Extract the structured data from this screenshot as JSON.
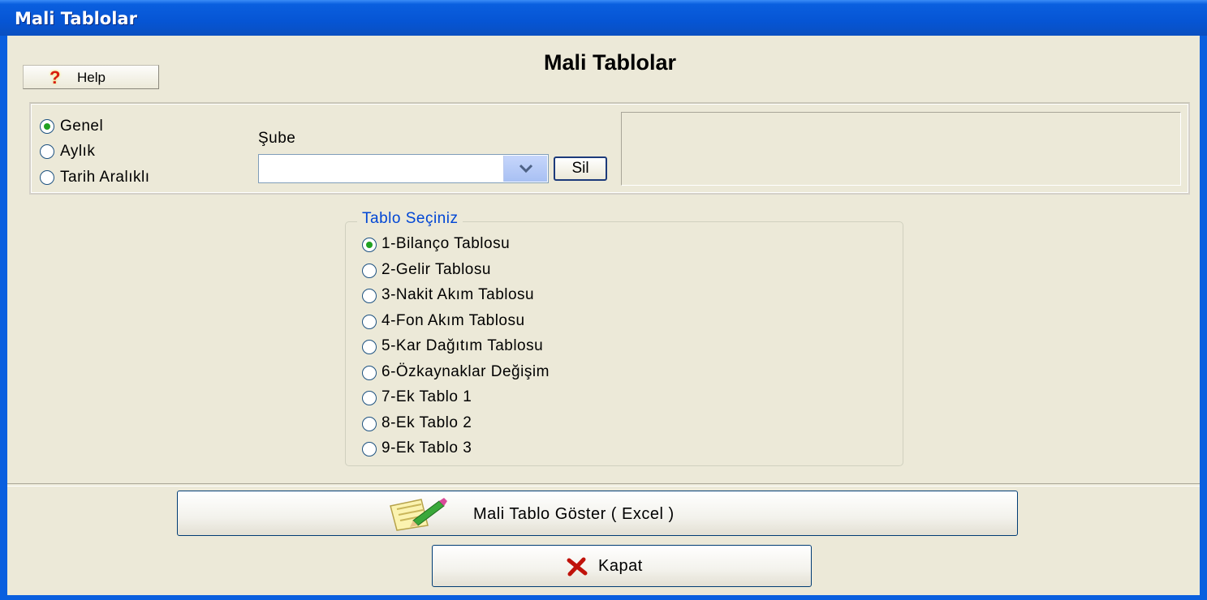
{
  "window": {
    "title": "Mali Tablolar"
  },
  "header": {
    "title": "Mali Tablolar",
    "help_label": "Help"
  },
  "period": {
    "options": [
      {
        "label": "Genel",
        "checked": true
      },
      {
        "label": "Aylık",
        "checked": false
      },
      {
        "label": "Tarih Aralıklı",
        "checked": false
      }
    ]
  },
  "branch": {
    "label": "Şube",
    "value": "",
    "clear_label": "Sil"
  },
  "table_group": {
    "legend": "Tablo Seçiniz",
    "options": [
      {
        "label": "1-Bilanço Tablosu",
        "checked": true
      },
      {
        "label": "2-Gelir Tablosu",
        "checked": false
      },
      {
        "label": "3-Nakit Akım Tablosu",
        "checked": false
      },
      {
        "label": "4-Fon Akım Tablosu",
        "checked": false
      },
      {
        "label": "5-Kar Dağıtım Tablosu",
        "checked": false
      },
      {
        "label": "6-Özkaynaklar Değişim",
        "checked": false
      },
      {
        "label": "7-Ek Tablo 1",
        "checked": false
      },
      {
        "label": "8-Ek Tablo 2",
        "checked": false
      },
      {
        "label": "9-Ek Tablo 3",
        "checked": false
      }
    ]
  },
  "actions": {
    "show_label": "Mali Tablo Göster ( Excel )",
    "close_label": "Kapat"
  },
  "colors": {
    "titlebar": "#0655d4",
    "background": "#ece9d8",
    "legend_text": "#0046d5",
    "radio_dot": "#21a121"
  }
}
